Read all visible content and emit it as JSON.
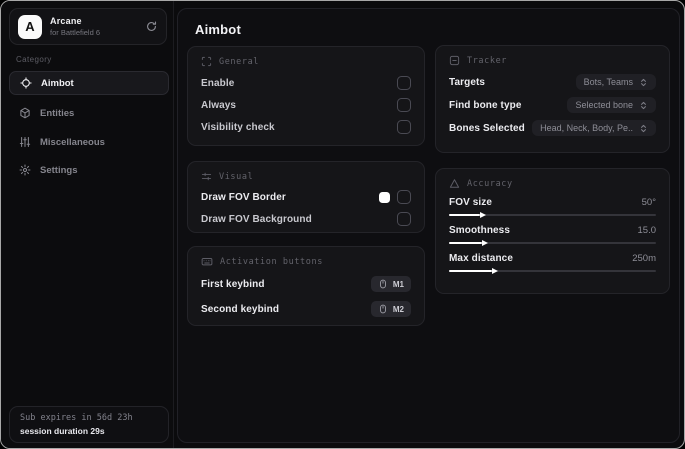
{
  "colors": {
    "fov_border_swatch": "#ffffff",
    "slider_fill": "#ffffff",
    "background": "#0b0b0d",
    "card_background": "#151518"
  },
  "sidebar": {
    "logo": {
      "initial": "A",
      "title": "Arcane",
      "subtitle": "for Battlefield 6",
      "action_icon": "refresh-icon"
    },
    "category_label": "Category",
    "items": [
      {
        "label": "Aimbot",
        "icon": "crosshair-icon",
        "active": true
      },
      {
        "label": "Entities",
        "icon": "cube-icon",
        "active": false
      },
      {
        "label": "Miscellaneous",
        "icon": "sliders-vertical-icon",
        "active": false
      },
      {
        "label": "Settings",
        "icon": "gear-icon",
        "active": false
      }
    ],
    "footer": {
      "sub_expires": "Sub expires in 56d 23h",
      "session_duration": "session duration 29s"
    }
  },
  "main": {
    "title": "Aimbot",
    "general": {
      "header": "General",
      "header_icon": "scan-icon",
      "rows": [
        {
          "label": "Enable",
          "checked": false
        },
        {
          "label": "Always",
          "checked": false
        },
        {
          "label": "Visibility check",
          "checked": false
        }
      ]
    },
    "visual": {
      "header": "Visual",
      "header_icon": "sliders-horizontal-icon",
      "rows": [
        {
          "label": "Draw FOV Border",
          "has_swatch": true,
          "swatch_color": "#ffffff",
          "checked": false
        },
        {
          "label": "Draw FOV Background",
          "has_swatch": false,
          "checked": false
        }
      ]
    },
    "activation": {
      "header": "Activation buttons",
      "header_icon": "keyboard-icon",
      "rows": [
        {
          "label": "First keybind",
          "key": "M1",
          "key_icon": "mouse-icon"
        },
        {
          "label": "Second keybind",
          "key": "M2",
          "key_icon": "mouse-icon"
        }
      ]
    },
    "tracker": {
      "header": "Tracker",
      "header_icon": "box-minus-icon",
      "rows": [
        {
          "label": "Targets",
          "value": "Bots, Teams"
        },
        {
          "label": "Find bone type",
          "value": "Selected bone"
        },
        {
          "label": "Bones Selected",
          "value": "Head, Neck, Body, Pe.."
        }
      ]
    },
    "accuracy": {
      "header": "Accuracy",
      "header_icon": "triangle-icon",
      "rows": [
        {
          "label": "FOV size",
          "value": "50°",
          "fill_percent": 15
        },
        {
          "label": "Smoothness",
          "value": "15.0",
          "fill_percent": 16
        },
        {
          "label": "Max distance",
          "value": "250m",
          "fill_percent": 21
        }
      ]
    }
  }
}
